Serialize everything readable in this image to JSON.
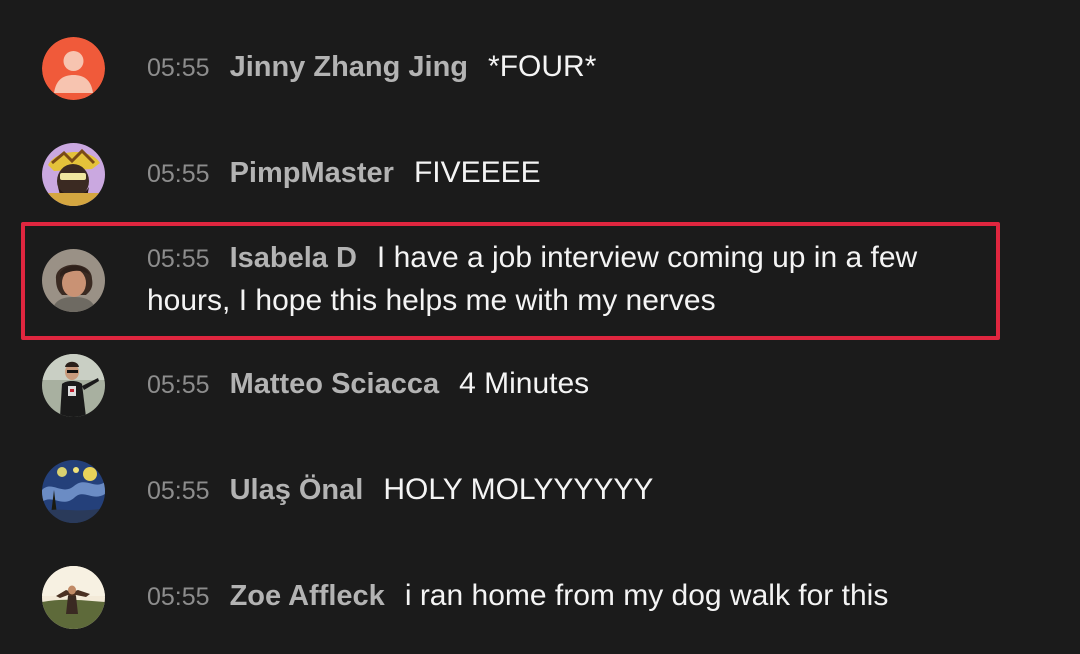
{
  "messages": [
    {
      "time": "05:55",
      "author": "Jinny Zhang Jing",
      "text": "*FOUR*",
      "avatar": "default-user-icon"
    },
    {
      "time": "05:55",
      "author": "PimpMaster",
      "text": "FIVEEEE",
      "avatar": "cartoon-avatar"
    },
    {
      "time": "05:55",
      "author": "Isabela D",
      "text": "I have a job interview coming up in a few hours, I hope this helps me with my nerves",
      "avatar": "photo-avatar",
      "highlighted": true
    },
    {
      "time": "05:55",
      "author": "Matteo Sciacca",
      "text": "4 Minutes",
      "avatar": "photo-avatar"
    },
    {
      "time": "05:55",
      "author": "Ulaş Önal",
      "text": "HOLY MOLYYYYYY",
      "avatar": "starry-night-avatar"
    },
    {
      "time": "05:55",
      "author": "Zoe Affleck",
      "text": "i ran home from my dog walk for this",
      "avatar": "photo-avatar"
    }
  ],
  "colors": {
    "background": "#1b1b1b",
    "highlight_border": "#e0263f",
    "default_avatar": "#f05a3a"
  }
}
